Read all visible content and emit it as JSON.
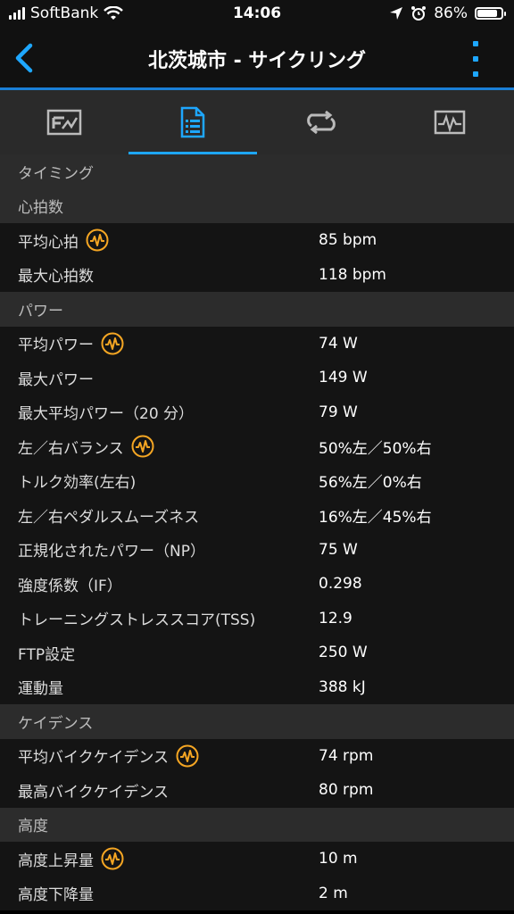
{
  "status_bar": {
    "carrier": "SoftBank",
    "time": "14:06",
    "battery": "86%",
    "battery_level": 0.86
  },
  "nav": {
    "title": "北茨城市 - サイクリング"
  },
  "tabs": [
    "summary-tab",
    "details-tab",
    "laps-tab",
    "chart-tab"
  ],
  "sections": [
    {
      "header": "タイミング",
      "rows": []
    },
    {
      "header": "心拍数",
      "rows": [
        {
          "label": "平均心拍",
          "value": "85 bpm",
          "icon": true
        },
        {
          "label": "最大心拍数",
          "value": "118 bpm",
          "icon": false
        }
      ]
    },
    {
      "header": "パワー",
      "rows": [
        {
          "label": "平均パワー",
          "value": "74 W",
          "icon": true
        },
        {
          "label": "最大パワー",
          "value": "149 W",
          "icon": false
        },
        {
          "label": "最大平均パワー（20 分）",
          "value": "79 W",
          "icon": false
        },
        {
          "label": "左／右バランス",
          "value": "50%左／50%右",
          "icon": true
        },
        {
          "label": "トルク効率(左右)",
          "value": "56%左／0%右",
          "icon": false
        },
        {
          "label": "左／右ペダルスムーズネス",
          "value": "16%左／45%右",
          "icon": false
        },
        {
          "label": "正規化されたパワー（NP）",
          "value": "75 W",
          "icon": false
        },
        {
          "label": "強度係数（IF）",
          "value": "0.298",
          "icon": false
        },
        {
          "label": "トレーニングストレススコア(TSS)",
          "value": "12.9",
          "icon": false
        },
        {
          "label": "FTP設定",
          "value": "250 W",
          "icon": false
        },
        {
          "label": "運動量",
          "value": "388 kJ",
          "icon": false
        }
      ]
    },
    {
      "header": "ケイデンス",
      "rows": [
        {
          "label": "平均バイクケイデンス",
          "value": "74 rpm",
          "icon": true
        },
        {
          "label": "最高バイクケイデンス",
          "value": "80 rpm",
          "icon": false
        }
      ]
    },
    {
      "header": "高度",
      "rows": [
        {
          "label": "高度上昇量",
          "value": "10 m",
          "icon": true
        },
        {
          "label": "高度下降量",
          "value": "2 m",
          "icon": false
        }
      ]
    }
  ],
  "colors": {
    "accent": "#1ea7ff",
    "chart_icon": "#f5a623"
  }
}
